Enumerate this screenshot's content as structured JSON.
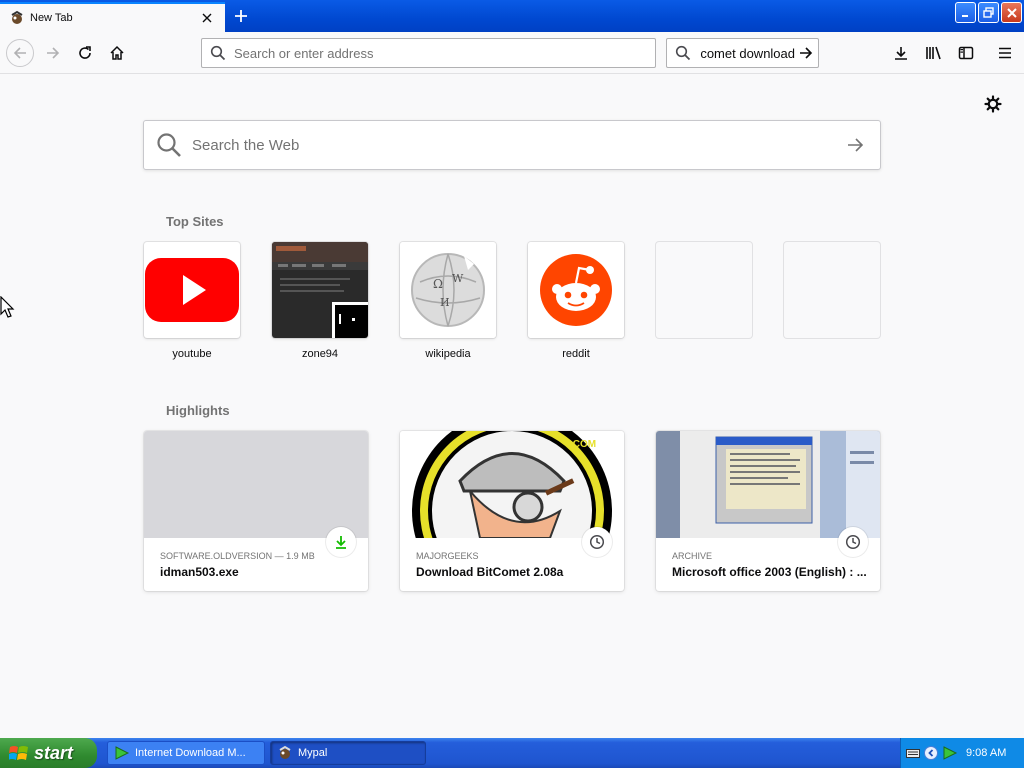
{
  "tab": {
    "title": "New Tab",
    "icon": "mypal-icon"
  },
  "toolbar": {
    "url_placeholder": "Search or enter address",
    "search_value": "comet download"
  },
  "content": {
    "web_search_placeholder": "Search the Web",
    "top_sites_title": "Top Sites",
    "top_sites": [
      {
        "label": "youtube"
      },
      {
        "label": "zone94"
      },
      {
        "label": "wikipedia"
      },
      {
        "label": "reddit"
      }
    ],
    "highlights_title": "Highlights",
    "highlights": [
      {
        "context": "SOFTWARE.OLDVERSION — 1.9 MB",
        "title": "idman503.exe",
        "badge": "download-icon"
      },
      {
        "context": "MAJORGEEKS",
        "title": "Download BitComet 2.08a",
        "badge": "clock-icon"
      },
      {
        "context": "ARCHIVE",
        "title": "Microsoft office 2003 (English) : ...",
        "badge": "clock-icon"
      }
    ]
  },
  "taskbar": {
    "start_label": "start",
    "tasks": [
      {
        "label": "Internet Download M..."
      },
      {
        "label": "Mypal"
      }
    ],
    "clock": "9:08 AM"
  },
  "colors": {
    "accent": "#0a84ff",
    "titlebar": "#0048d0",
    "youtube": "#ff0000",
    "reddit": "#ff4500",
    "download_green": "#12bc00",
    "start_green": "#2f8a2f"
  }
}
